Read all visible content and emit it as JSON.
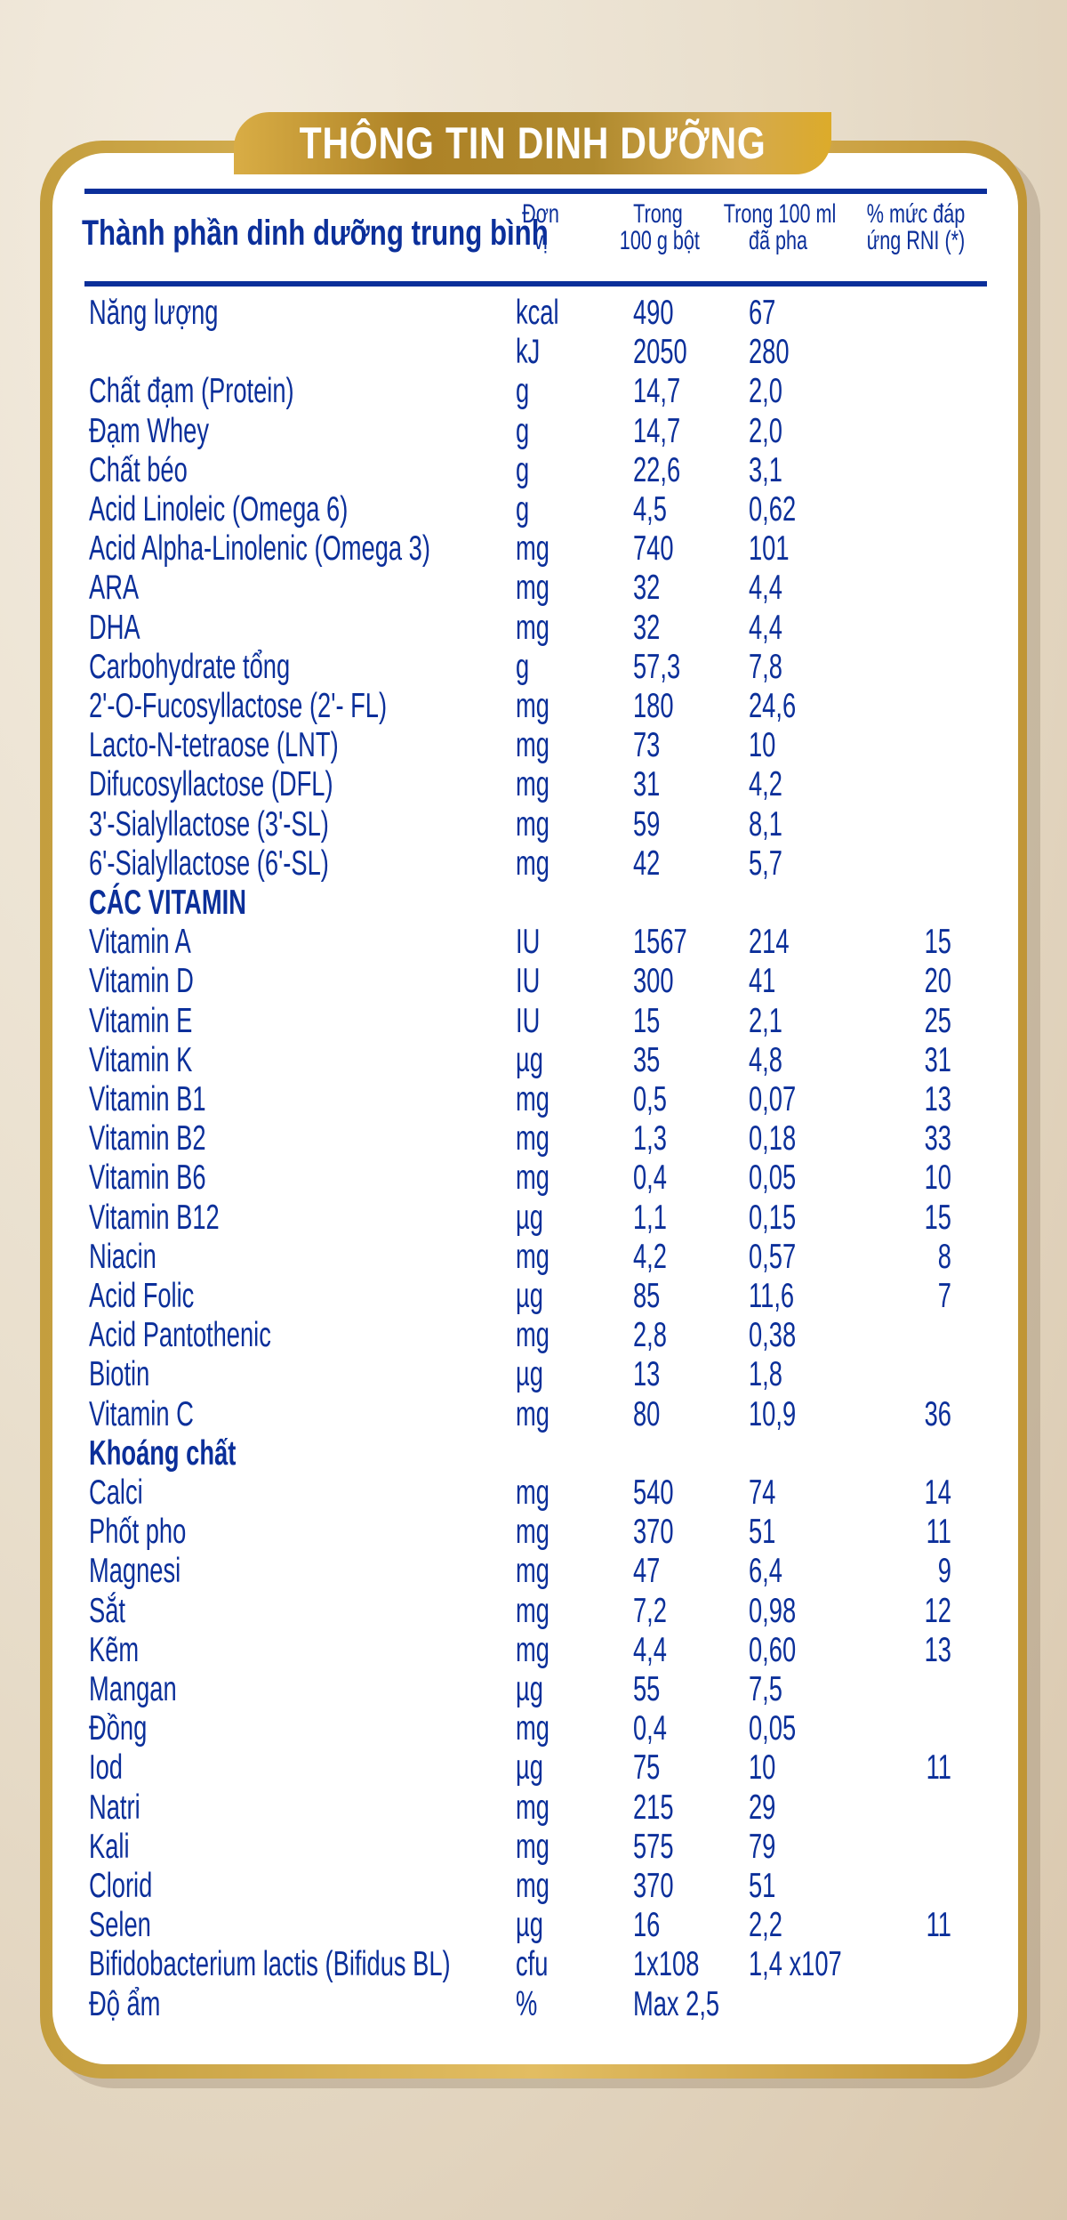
{
  "title": "THÔNG TIN DINH DƯỠNG",
  "headers": {
    "name": "Thành phần dinh dưỡng trung bình",
    "unit": [
      "Đơn",
      "vị"
    ],
    "per_100g": [
      "Trong",
      "100 g bột"
    ],
    "per_100ml": [
      "Trong 100 ml",
      "đã pha"
    ],
    "rni": [
      "% mức đáp",
      "ứng RNI (*)"
    ]
  },
  "colors": {
    "text": "#0b2f9a",
    "gold": "#c49e3e",
    "background": "#e9dfcd"
  },
  "rows": [
    {
      "name": "Năng lượng",
      "unit": "kcal",
      "g": "490",
      "ml": "67",
      "rni": ""
    },
    {
      "name": "",
      "unit": "kJ",
      "g": "2050",
      "ml": "280",
      "rni": ""
    },
    {
      "name": "Chất đạm (Protein)",
      "unit": "g",
      "g": "14,7",
      "ml": "2,0",
      "rni": ""
    },
    {
      "name": "Đạm Whey",
      "unit": "g",
      "g": "14,7",
      "ml": "2,0",
      "rni": ""
    },
    {
      "name": "Chất béo",
      "unit": "g",
      "g": "22,6",
      "ml": "3,1",
      "rni": ""
    },
    {
      "name": "Acid Linoleic (Omega 6)",
      "unit": "g",
      "g": "4,5",
      "ml": "0,62",
      "rni": ""
    },
    {
      "name": "Acid  Alpha-Linolenic (Omega 3)",
      "unit": "mg",
      "g": "740",
      "ml": "101",
      "rni": ""
    },
    {
      "name": "ARA",
      "unit": "mg",
      "g": "32",
      "ml": "4,4",
      "rni": ""
    },
    {
      "name": "DHA",
      "unit": "mg",
      "g": "32",
      "ml": "4,4",
      "rni": ""
    },
    {
      "name": "Carbohydrate tổng",
      "unit": "g",
      "g": "57,3",
      "ml": "7,8",
      "rni": ""
    },
    {
      "name": "2'-O-Fucosyllactose (2'- FL)",
      "unit": "mg",
      "g": "180",
      "ml": "24,6",
      "rni": ""
    },
    {
      "name": "Lacto-N-tetraose (LNT)",
      "unit": "mg",
      "g": "73",
      "ml": "10",
      "rni": ""
    },
    {
      "name": "Difucosyllactose (DFL)",
      "unit": "mg",
      "g": "31",
      "ml": "4,2",
      "rni": ""
    },
    {
      "name": "3'-Sialyllactose (3'-SL)",
      "unit": "mg",
      "g": "59",
      "ml": "8,1",
      "rni": ""
    },
    {
      "name": "6'-Sialyllactose (6'-SL)",
      "unit": "mg",
      "g": "42",
      "ml": "5,7",
      "rni": ""
    },
    {
      "name": "CÁC VITAMIN",
      "section": true,
      "unit": "",
      "g": "",
      "ml": "",
      "rni": ""
    },
    {
      "name": "Vitamin A",
      "unit": "IU",
      "g": "1567",
      "ml": "214",
      "rni": "15"
    },
    {
      "name": "Vitamin D",
      "unit": "IU",
      "g": "300",
      "ml": "41",
      "rni": "20"
    },
    {
      "name": "Vitamin E",
      "unit": "IU",
      "g": "15",
      "ml": "2,1",
      "rni": "25"
    },
    {
      "name": "Vitamin K",
      "unit": "µg",
      "g": "35",
      "ml": "4,8",
      "rni": "31"
    },
    {
      "name": "Vitamin B1",
      "unit": "mg",
      "g": "0,5",
      "ml": "0,07",
      "rni": "13"
    },
    {
      "name": "Vitamin B2",
      "unit": "mg",
      "g": "1,3",
      "ml": "0,18",
      "rni": "33"
    },
    {
      "name": "Vitamin B6",
      "unit": "mg",
      "g": "0,4",
      "ml": "0,05",
      "rni": "10"
    },
    {
      "name": "Vitamin B12",
      "unit": "µg",
      "g": "1,1",
      "ml": "0,15",
      "rni": "15"
    },
    {
      "name": "Niacin",
      "unit": "mg",
      "g": "4,2",
      "ml": "0,57",
      "rni": "8"
    },
    {
      "name": "Acid Folic",
      "unit": "µg",
      "g": "85",
      "ml": "11,6",
      "rni": "7"
    },
    {
      "name": "Acid Pantothenic",
      "unit": "mg",
      "g": "2,8",
      "ml": "0,38",
      "rni": ""
    },
    {
      "name": "Biotin",
      "unit": "µg",
      "g": "13",
      "ml": "1,8",
      "rni": ""
    },
    {
      "name": "Vitamin C",
      "unit": "mg",
      "g": "80",
      "ml": "10,9",
      "rni": "36"
    },
    {
      "name": "Khoáng chất",
      "section": true,
      "unit": "",
      "g": "",
      "ml": "",
      "rni": ""
    },
    {
      "name": "Calci",
      "unit": "mg",
      "g": "540",
      "ml": "74",
      "rni": "14"
    },
    {
      "name": "Phốt pho",
      "unit": "mg",
      "g": "370",
      "ml": "51",
      "rni": "11"
    },
    {
      "name": "Magnesi",
      "unit": "mg",
      "g": "47",
      "ml": "6,4",
      "rni": "9"
    },
    {
      "name": "Sắt",
      "unit": "mg",
      "g": "7,2",
      "ml": "0,98",
      "rni": "12"
    },
    {
      "name": "Kẽm",
      "unit": "mg",
      "g": "4,4",
      "ml": "0,60",
      "rni": "13"
    },
    {
      "name": "Mangan",
      "unit": "µg",
      "g": "55",
      "ml": "7,5",
      "rni": ""
    },
    {
      "name": "Đồng",
      "unit": "mg",
      "g": "0,4",
      "ml": "0,05",
      "rni": ""
    },
    {
      "name": "Iod",
      "unit": "µg",
      "g": "75",
      "ml": "10",
      "rni": "11"
    },
    {
      "name": "Natri",
      "unit": "mg",
      "g": "215",
      "ml": "29",
      "rni": ""
    },
    {
      "name": "Kali",
      "unit": "mg",
      "g": "575",
      "ml": "79",
      "rni": ""
    },
    {
      "name": "Clorid",
      "unit": "mg",
      "g": "370",
      "ml": "51",
      "rni": ""
    },
    {
      "name": "Selen",
      "unit": "µg",
      "g": "16",
      "ml": "2,2",
      "rni": "11"
    },
    {
      "name": "Bifidobacterium lactis (Bifidus BL)",
      "unit": "cfu",
      "g": "1x108",
      "ml": "1,4 x107",
      "rni": ""
    },
    {
      "name": "Độ ẩm",
      "unit": "%",
      "g": "Max 2,5",
      "ml": "",
      "rni": ""
    }
  ]
}
